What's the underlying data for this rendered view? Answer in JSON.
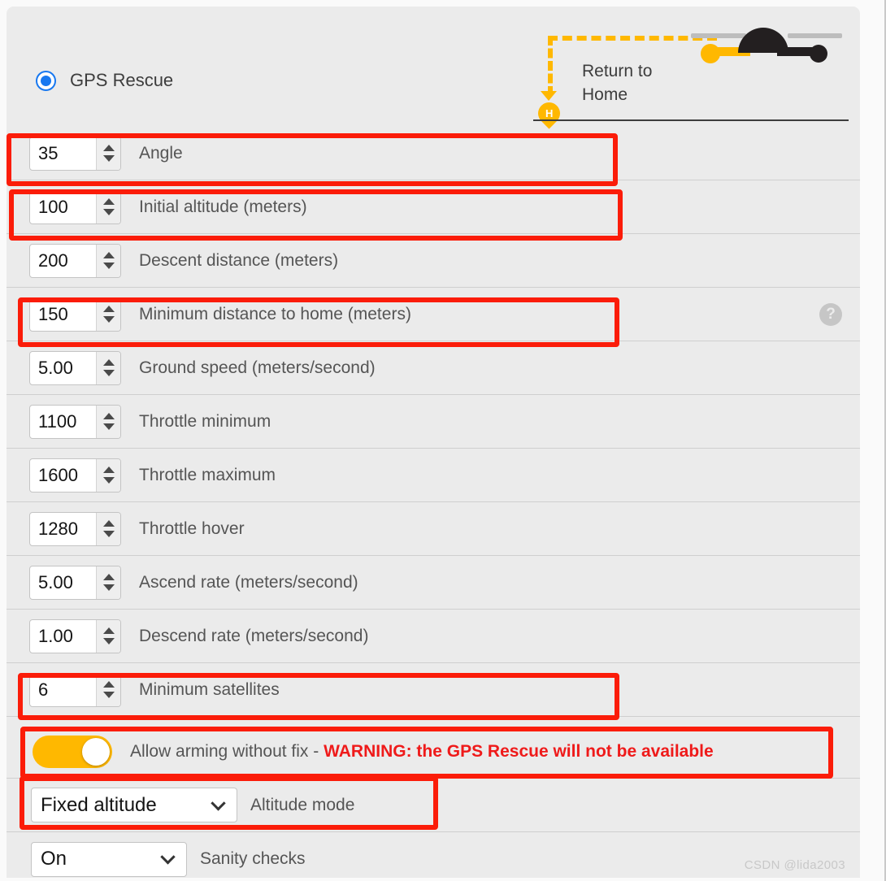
{
  "panel": {
    "radio": {
      "label": "GPS Rescue",
      "selected": true,
      "accent": "#1878f0"
    },
    "illustration": {
      "caption": "Return to\nHome",
      "home_marker_letter": "H",
      "path_color": "#ffb800",
      "drone_body_color": "#231f20"
    }
  },
  "rows": [
    {
      "name": "angle",
      "value": "35",
      "label": "Angle",
      "highlighted": true
    },
    {
      "name": "initial-altitude",
      "value": "100",
      "label": "Initial altitude (meters)",
      "highlighted": true
    },
    {
      "name": "descent-distance",
      "value": "200",
      "label": "Descent distance (meters)",
      "highlighted": false
    },
    {
      "name": "minimum-distance-home",
      "value": "150",
      "label": "Minimum distance to home (meters)",
      "highlighted": true,
      "help": "?"
    },
    {
      "name": "ground-speed",
      "value": "5.00",
      "label": "Ground speed (meters/second)",
      "highlighted": false
    },
    {
      "name": "throttle-minimum",
      "value": "1100",
      "label": "Throttle minimum",
      "highlighted": false
    },
    {
      "name": "throttle-maximum",
      "value": "1600",
      "label": "Throttle maximum",
      "highlighted": false
    },
    {
      "name": "throttle-hover",
      "value": "1280",
      "label": "Throttle hover",
      "highlighted": false
    },
    {
      "name": "ascend-rate",
      "value": "5.00",
      "label": "Ascend rate (meters/second)",
      "highlighted": false
    },
    {
      "name": "descend-rate",
      "value": "1.00",
      "label": "Descend rate (meters/second)",
      "highlighted": false
    },
    {
      "name": "minimum-satellites",
      "value": "6",
      "label": "Minimum satellites",
      "highlighted": true
    }
  ],
  "toggle_row": {
    "name": "allow-arming-without-fix",
    "state": "on",
    "color": "#ffb800",
    "label": "Allow arming without fix - ",
    "warning": "WARNING: the GPS Rescue will not be available",
    "warning_color": "#ef1a1a",
    "highlighted": true
  },
  "select_rows": [
    {
      "name": "altitude-mode",
      "value": "Fixed altitude",
      "label": "Altitude mode",
      "highlighted": true
    },
    {
      "name": "sanity-checks",
      "value": "On",
      "label": "Sanity checks",
      "highlighted": false
    }
  ],
  "watermark": "CSDN @lida2003"
}
